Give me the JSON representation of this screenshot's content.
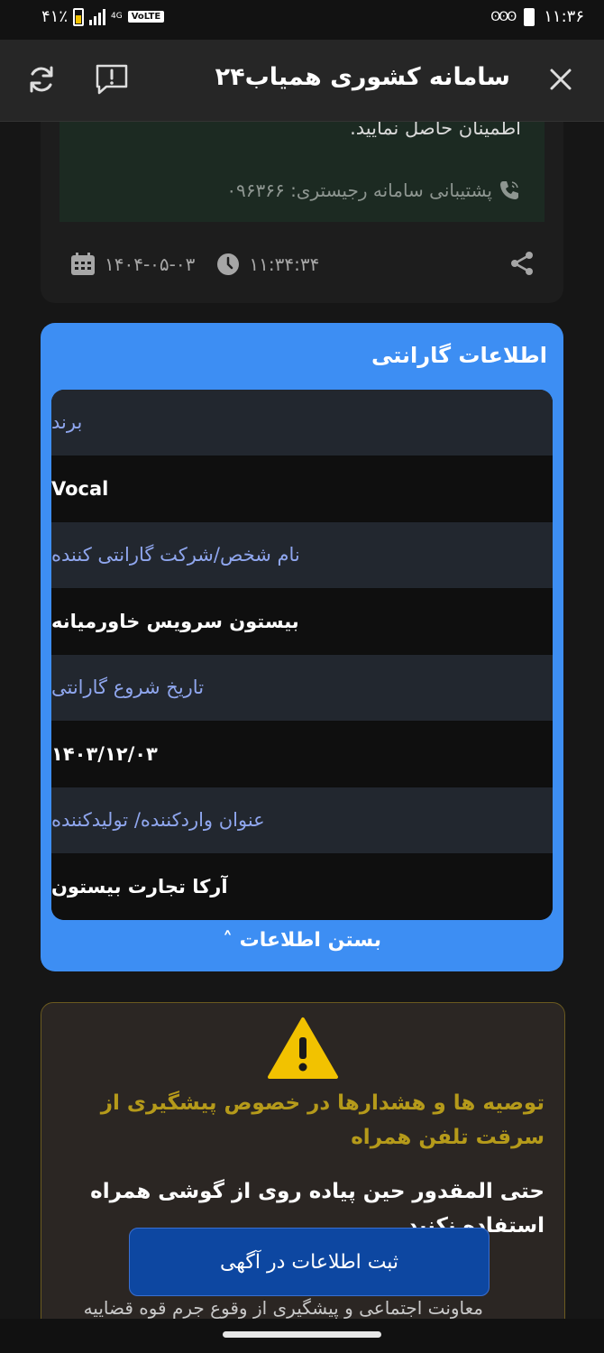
{
  "status_bar": {
    "battery_percent": "۴۱٪",
    "network": "4G",
    "volte": "VoLTE",
    "time": "۱۱:۳۶"
  },
  "header": {
    "title": "سامانه کشوری همیاب۲۴"
  },
  "news_card": {
    "text": "اطمینان حاصل نمایید.",
    "support": "پشتیبانی سامانه رجیستری: ۰۹۶۳۶۶",
    "time": "۱۱:۳۴:۳۴",
    "date": "۱۴۰۴-۰۵-۰۳"
  },
  "warranty": {
    "title": "اطلاعات گارانتی",
    "rows": [
      {
        "label": "برند",
        "value": "Vocal"
      },
      {
        "label": "نام شخص/شرکت گارانتی کننده",
        "value": "بیستون سرویس خاورمیانه"
      },
      {
        "label": "تاریخ شروع گارانتی",
        "value": "۱۴۰۳/۱۲/۰۳"
      },
      {
        "label": "عنوان واردکننده/ تولیدکننده",
        "value": "آرکا تجارت بیستون"
      }
    ],
    "toggle_label": "بستن اطلاعات ˄"
  },
  "warning": {
    "title": "توصیه ها و هشدارها در خصوص پیشگیری از سرقت تلفن همراه",
    "body": "حتی المقدور حین پیاده روی از گوشی همراه استفاده نکنید.",
    "footer": "معاونت اجتماعی و پیشگیری از وقوع جرم قوه قضاییه"
  },
  "submit_button": "ثبت اطلاعات در آگهی"
}
